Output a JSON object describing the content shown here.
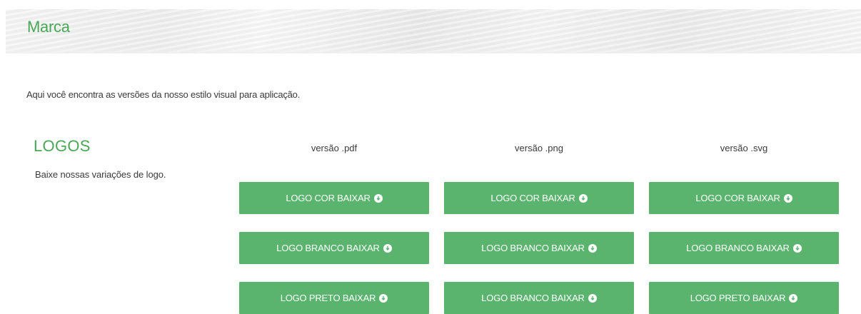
{
  "header": {
    "title": "Marca"
  },
  "intro": "Aqui você encontra as versões da nosso estilo visual para aplicação.",
  "section": {
    "title": "LOGOS",
    "description": "Baixe nossas variações de logo."
  },
  "columns": [
    {
      "heading": "versão .pdf",
      "buttons": [
        "LOGO COR BAIXAR",
        "LOGO BRANCO BAIXAR",
        "LOGO PRETO BAIXAR"
      ]
    },
    {
      "heading": "versão .png",
      "buttons": [
        "LOGO COR BAIXAR",
        "LOGO BRANCO BAIXAR",
        "LOGO BRANCO BAIXAR"
      ]
    },
    {
      "heading": "versão .svg",
      "buttons": [
        "LOGO COR BAIXAR",
        "LOGO BRANCO BAIXAR",
        "LOGO PRETO BAIXAR"
      ]
    }
  ],
  "icons": {
    "download": "download-circle-icon"
  },
  "colors": {
    "accent": "#49a857",
    "button": "#5bb46e"
  }
}
